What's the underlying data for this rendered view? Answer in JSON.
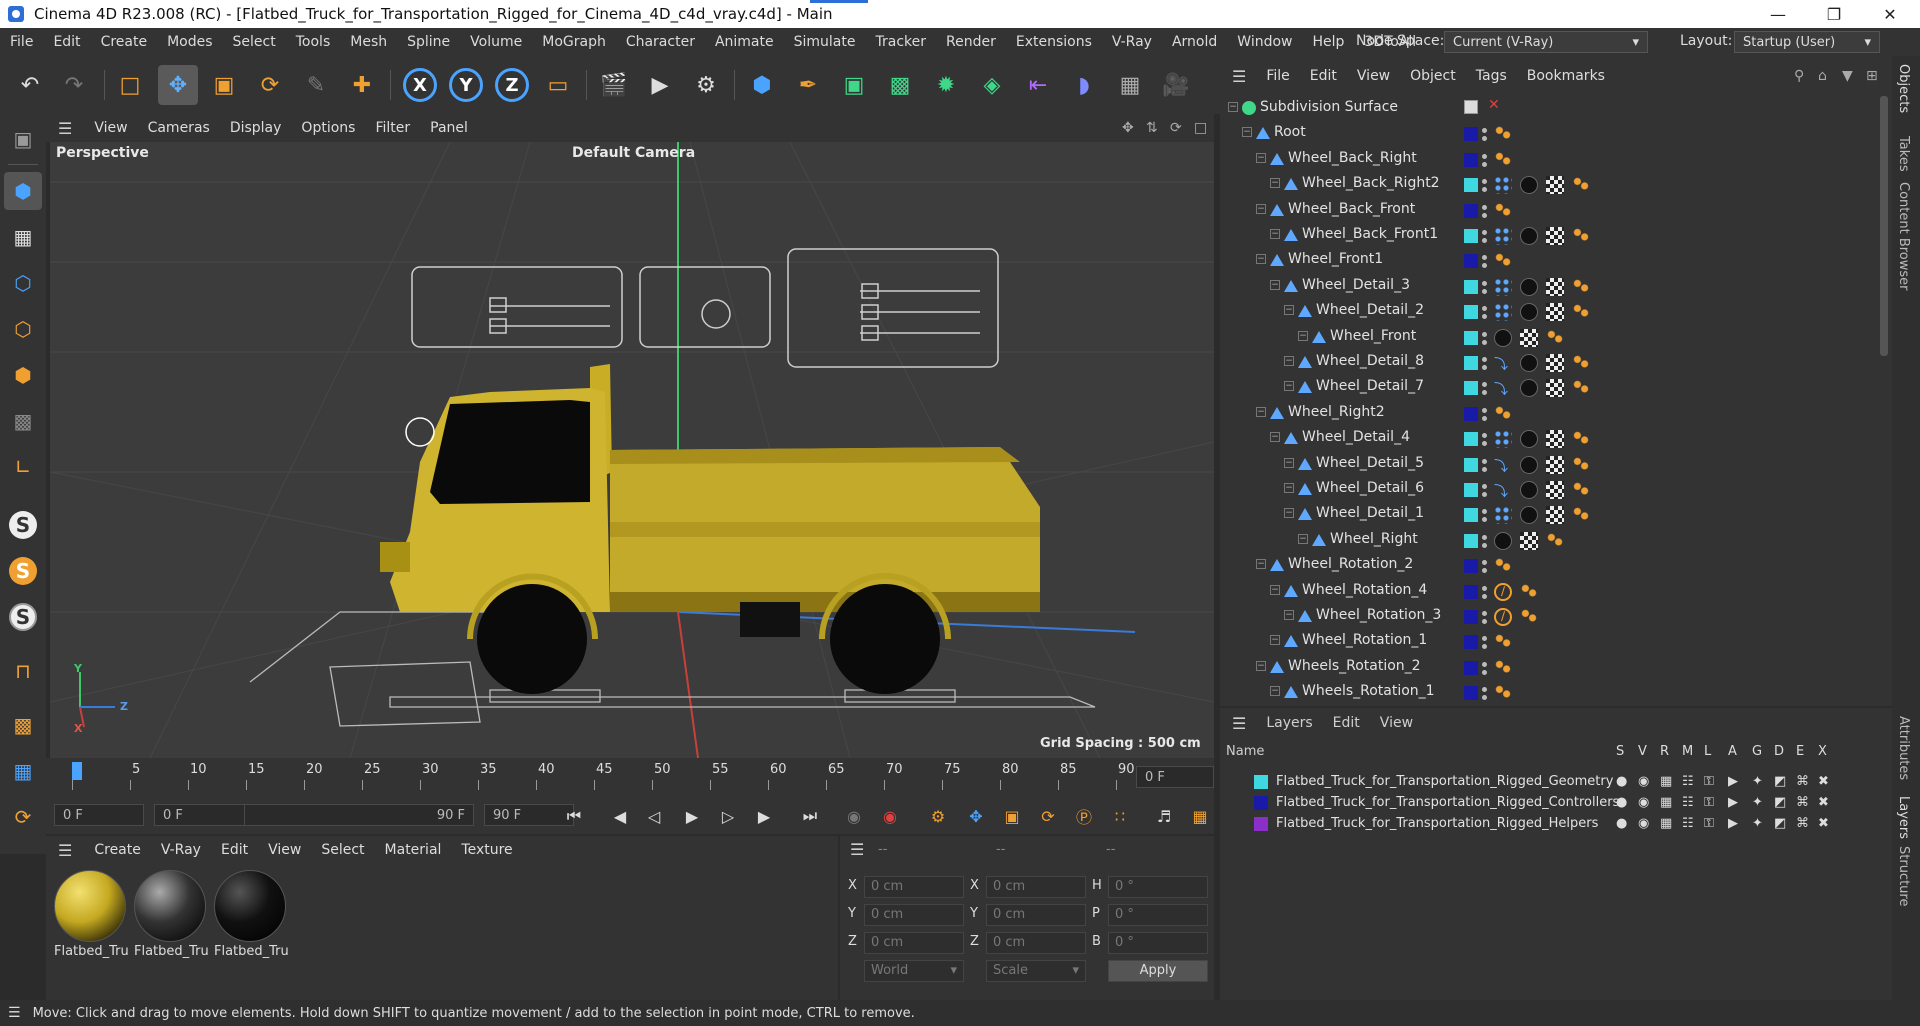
{
  "window": {
    "title": "Cinema 4D R23.008 (RC) - [Flatbed_Truck_for_Transportation_Rigged_for_Cinema_4D_c4d_vray.c4d] - Main",
    "minimize": "—",
    "maximize": "❐",
    "close": "✕"
  },
  "menubar": {
    "items": [
      "File",
      "Edit",
      "Create",
      "Modes",
      "Select",
      "Tools",
      "Mesh",
      "Spline",
      "Volume",
      "MoGraph",
      "Character",
      "Animate",
      "Simulate",
      "Tracker",
      "Render",
      "Extensions",
      "V-Ray",
      "Arnold",
      "Window",
      "Help",
      "3DToAll"
    ],
    "node_space_label": "Node Space:",
    "node_space_value": "Current (V-Ray)",
    "layout_label": "Layout:",
    "layout_value": "Startup (User)"
  },
  "viewport": {
    "menu": [
      "View",
      "Cameras",
      "Display",
      "Options",
      "Filter",
      "Panel"
    ],
    "view_name": "Perspective",
    "camera": "Default Camera",
    "grid_spacing": "Grid Spacing : 500 cm",
    "axis_y": "Y",
    "axis_z": "Z",
    "axis_x": "X"
  },
  "timeline": {
    "ticks": [
      "0",
      "5",
      "10",
      "15",
      "20",
      "25",
      "30",
      "35",
      "40",
      "45",
      "50",
      "55",
      "60",
      "65",
      "70",
      "75",
      "80",
      "85",
      "90"
    ],
    "current_frame": "0 F"
  },
  "playback": {
    "start": "0 F",
    "range_start": "0 F",
    "range_end": "90 F",
    "end": "90 F"
  },
  "material_manager": {
    "menu": [
      "Create",
      "V-Ray",
      "Edit",
      "View",
      "Select",
      "Material",
      "Texture"
    ],
    "materials": [
      {
        "name": "Flatbed_Tru"
      },
      {
        "name": "Flatbed_Tru"
      },
      {
        "name": "Flatbed_Tru"
      }
    ]
  },
  "coordinates": {
    "headers": [
      "--",
      "--",
      "--"
    ],
    "rows": [
      {
        "a": "X",
        "av": "0 cm",
        "b": "X",
        "bv": "0 cm",
        "c": "H",
        "cv": "0 °"
      },
      {
        "a": "Y",
        "av": "0 cm",
        "b": "Y",
        "bv": "0 cm",
        "c": "P",
        "cv": "0 °"
      },
      {
        "a": "Z",
        "av": "0 cm",
        "b": "Z",
        "bv": "0 cm",
        "c": "B",
        "cv": "0 °"
      }
    ],
    "world": "World",
    "scale": "Scale",
    "apply": "Apply"
  },
  "status": {
    "text": "Move: Click and drag to move elements. Hold down SHIFT to quantize movement / add to the selection in point mode, CTRL to remove."
  },
  "objects": {
    "menu": [
      "File",
      "Edit",
      "View",
      "Object",
      "Tags",
      "Bookmarks"
    ],
    "rows": [
      {
        "name": "Subdivision Surface",
        "level": 0,
        "color": "#888888",
        "kind": "root"
      },
      {
        "name": "Root",
        "level": 1,
        "color": "#1a1aa8",
        "kind": "ctrl"
      },
      {
        "name": "Wheel_Back_Right",
        "level": 2,
        "color": "#1a1aa8",
        "kind": "ctrl"
      },
      {
        "name": "Wheel_Back_Right2",
        "level": 3,
        "color": "#3fd8e0",
        "kind": "geo"
      },
      {
        "name": "Wheel_Back_Front",
        "level": 2,
        "color": "#1a1aa8",
        "kind": "ctrl"
      },
      {
        "name": "Wheel_Back_Front1",
        "level": 3,
        "color": "#3fd8e0",
        "kind": "geo"
      },
      {
        "name": "Wheel_Front1",
        "level": 2,
        "color": "#1a1aa8",
        "kind": "ctrl"
      },
      {
        "name": "Wheel_Detail_3",
        "level": 3,
        "color": "#3fd8e0",
        "kind": "geo"
      },
      {
        "name": "Wheel_Detail_2",
        "level": 4,
        "color": "#3fd8e0",
        "kind": "geo"
      },
      {
        "name": "Wheel_Front",
        "level": 5,
        "color": "#3fd8e0",
        "kind": "geo2"
      },
      {
        "name": "Wheel_Detail_8",
        "level": 4,
        "color": "#3fd8e0",
        "kind": "geo3"
      },
      {
        "name": "Wheel_Detail_7",
        "level": 4,
        "color": "#3fd8e0",
        "kind": "geo3"
      },
      {
        "name": "Wheel_Right2",
        "level": 2,
        "color": "#1a1aa8",
        "kind": "ctrl"
      },
      {
        "name": "Wheel_Detail_4",
        "level": 3,
        "color": "#3fd8e0",
        "kind": "geo"
      },
      {
        "name": "Wheel_Detail_5",
        "level": 4,
        "color": "#3fd8e0",
        "kind": "geo3"
      },
      {
        "name": "Wheel_Detail_6",
        "level": 4,
        "color": "#3fd8e0",
        "kind": "geo3"
      },
      {
        "name": "Wheel_Detail_1",
        "level": 4,
        "color": "#3fd8e0",
        "kind": "geo"
      },
      {
        "name": "Wheel_Right",
        "level": 5,
        "color": "#3fd8e0",
        "kind": "geo2"
      },
      {
        "name": "Wheel_Rotation_2",
        "level": 2,
        "color": "#1a1aa8",
        "kind": "ctrl"
      },
      {
        "name": "Wheel_Rotation_4",
        "level": 3,
        "color": "#1a1aa8",
        "kind": "rot"
      },
      {
        "name": "Wheel_Rotation_3",
        "level": 4,
        "color": "#1a1aa8",
        "kind": "rot"
      },
      {
        "name": "Wheel_Rotation_1",
        "level": 3,
        "color": "#1a1aa8",
        "kind": "ctrl"
      },
      {
        "name": "Wheels_Rotation_2",
        "level": 2,
        "color": "#1a1aa8",
        "kind": "ctrl"
      },
      {
        "name": "Wheels_Rotation_1",
        "level": 3,
        "color": "#1a1aa8",
        "kind": "ctrl"
      }
    ]
  },
  "layers": {
    "menu": [
      "Layers",
      "Edit",
      "View"
    ],
    "col_name": "Name",
    "cols": [
      "S",
      "V",
      "R",
      "M",
      "L",
      "A",
      "G",
      "D",
      "E",
      "X"
    ],
    "rows": [
      {
        "name": "Flatbed_Truck_for_Transportation_Rigged_Geometry",
        "color": "#3fd8e0"
      },
      {
        "name": "Flatbed_Truck_for_Transportation_Rigged_Controllers",
        "color": "#1a1aa8"
      },
      {
        "name": "Flatbed_Truck_for_Transportation_Rigged_Helpers",
        "color": "#8a2fc8"
      }
    ]
  },
  "right_dock": [
    "Objects",
    "Takes",
    "Content Browser",
    "Attributes",
    "Layers",
    "Structure"
  ]
}
